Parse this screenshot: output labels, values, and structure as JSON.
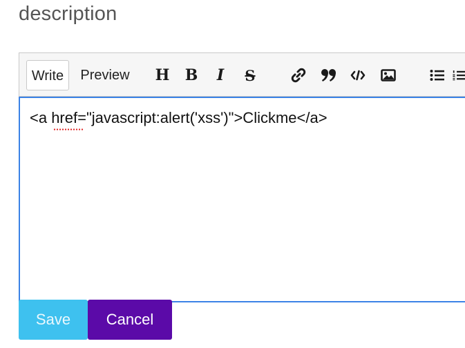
{
  "form": {
    "heading": "description"
  },
  "editor": {
    "tabs": {
      "write": "Write",
      "preview": "Preview"
    },
    "toolbar": {
      "heading": "H",
      "bold": "B",
      "italic": "I",
      "strikethrough": "S",
      "icons": [
        "heading-icon",
        "bold-icon",
        "italic-icon",
        "strikethrough-icon",
        "link-icon",
        "quote-icon",
        "code-icon",
        "image-icon",
        "unordered-list-icon",
        "ordered-list-icon"
      ]
    },
    "content": "<a href=\"javascript:alert('xss')\">Clickme</a>",
    "focus_color": "#3b82e6"
  },
  "actions": {
    "save_label": "Save",
    "cancel_label": "Cancel",
    "save_color": "#3ec1ef",
    "cancel_color": "#5b0aa8"
  }
}
